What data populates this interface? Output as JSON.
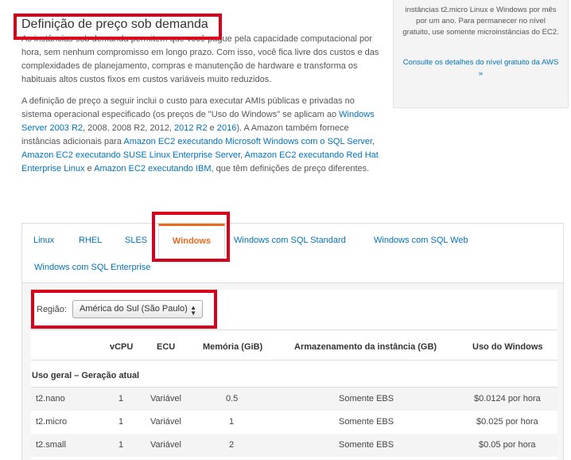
{
  "header": {
    "title": "Definição de preço sob demanda"
  },
  "intro": {
    "paragraph1": "As instâncias sob demanda permitem que você pague pela capacidade computacional por hora, sem nenhum compromisso em longo prazo. Com isso, você fica livre dos custos e das complexidades de planejamento, compras e manutenção de hardware e transforma os habituais altos custos fixos em custos variáveis muito reduzidos.",
    "p2_a": "A definição de preço a seguir inclui o custo para executar AMIs públicas e privadas no sistema operacional especificado (os preços de \"Uso do Windows\" se aplicam ao ",
    "p2_link1": "Windows Server 2003 R2",
    "p2_b": ", 2008, 2008 R2, 2012, ",
    "p2_link2": "2012 R2",
    "p2_c": " e ",
    "p2_link3": "2016",
    "p2_d": "). A Amazon também fornece instâncias adicionais para ",
    "p2_link4": "Amazon EC2 executando Microsoft Windows com o SQL Server",
    "p2_e": ", ",
    "p2_link5": "Amazon EC2 executando SUSE Linux Enterprise Server",
    "p2_f": ", ",
    "p2_link6": "Amazon EC2 executando Red Hat Enterprise Linux",
    "p2_g": " e ",
    "p2_link7": "Amazon EC2 executando IBM",
    "p2_h": ", que têm definições de preço diferentes."
  },
  "sidebar": {
    "text": "instâncias t2.micro Linux e Windows por mês por um ano. Para permanecer no nível gratuito, use somente microinstâncias do EC2.",
    "link": "Consulte os detalhes do nível gratuito da AWS »"
  },
  "tabs": [
    {
      "label": "Linux",
      "active": false
    },
    {
      "label": "RHEL",
      "active": false
    },
    {
      "label": "SLES",
      "active": false
    },
    {
      "label": "Windows",
      "active": true
    },
    {
      "label": "Windows com SQL Standard",
      "active": false
    },
    {
      "label": "Windows com SQL Web",
      "active": false
    },
    {
      "label": "Windows com SQL Enterprise",
      "active": false
    }
  ],
  "region": {
    "label": "Região:",
    "selected": "América do Sul (São Paulo)"
  },
  "table": {
    "headers": [
      "vCPU",
      "ECU",
      "Memória (GiB)",
      "Armazenamento da instância (GB)",
      "Uso do Windows"
    ],
    "section": "Uso geral – Geração atual",
    "rows": [
      [
        "t2.nano",
        "1",
        "Variável",
        "0.5",
        "Somente EBS",
        "$0.0124 por hora"
      ],
      [
        "t2.micro",
        "1",
        "Variável",
        "1",
        "Somente EBS",
        "$0.025 por hora"
      ],
      [
        "t2.small",
        "1",
        "Variável",
        "2",
        "Somente EBS",
        "$0.05 por hora"
      ]
    ]
  },
  "colors": {
    "link": "#0073bb",
    "active_tab": "#ea6a1f",
    "highlight_box": "#d9001b"
  }
}
